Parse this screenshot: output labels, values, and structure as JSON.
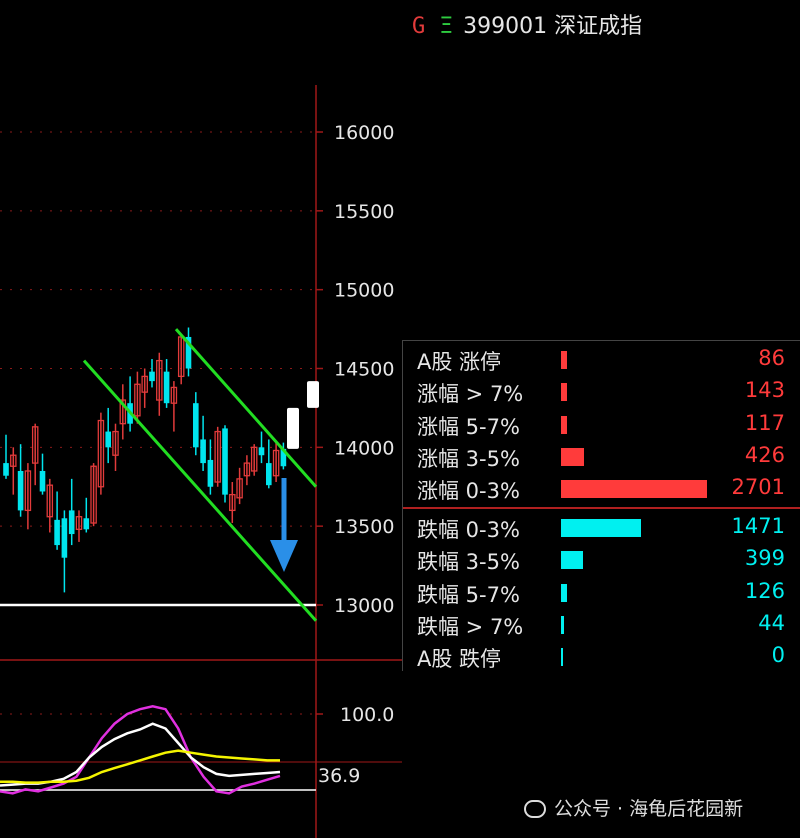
{
  "header": {
    "g_label": "G",
    "eq_label": "Ξ",
    "title": "399001 深证成指"
  },
  "chart_data": [
    {
      "type": "candlestick",
      "title": "",
      "yticks": [
        16000,
        15500,
        15000,
        14500,
        14000,
        13500,
        13000
      ],
      "ylim": [
        12900,
        16500
      ],
      "support_level": 13000,
      "channel_upper": [
        [
          14750,
          13750
        ]
      ],
      "channel_lower": [
        [
          14550,
          12900
        ]
      ],
      "colors": {
        "up": "#e23b3b",
        "down": "#00e5ee",
        "channel": "#22dd22",
        "support": "#ffffff",
        "arrow": "#2a8fe8"
      },
      "candles": [
        {
          "o": 13900,
          "h": 14080,
          "l": 13800,
          "c": 13820
        },
        {
          "o": 13880,
          "h": 14000,
          "l": 13700,
          "c": 13950
        },
        {
          "o": 13850,
          "h": 14020,
          "l": 13560,
          "c": 13600
        },
        {
          "o": 13600,
          "h": 13900,
          "l": 13480,
          "c": 13850
        },
        {
          "o": 13900,
          "h": 14150,
          "l": 13760,
          "c": 14130
        },
        {
          "o": 13850,
          "h": 13960,
          "l": 13700,
          "c": 13720
        },
        {
          "o": 13560,
          "h": 13800,
          "l": 13460,
          "c": 13760
        },
        {
          "o": 13540,
          "h": 13720,
          "l": 13350,
          "c": 13380
        },
        {
          "o": 13550,
          "h": 13600,
          "l": 13080,
          "c": 13300
        },
        {
          "o": 13600,
          "h": 13800,
          "l": 13380,
          "c": 13450
        },
        {
          "o": 13480,
          "h": 13600,
          "l": 13400,
          "c": 13560
        },
        {
          "o": 13550,
          "h": 13680,
          "l": 13460,
          "c": 13480
        },
        {
          "o": 13520,
          "h": 13900,
          "l": 13500,
          "c": 13880
        },
        {
          "o": 13750,
          "h": 14220,
          "l": 13700,
          "c": 14170
        },
        {
          "o": 14100,
          "h": 14250,
          "l": 13900,
          "c": 14000
        },
        {
          "o": 13950,
          "h": 14150,
          "l": 13850,
          "c": 14100
        },
        {
          "o": 14150,
          "h": 14400,
          "l": 14050,
          "c": 14300
        },
        {
          "o": 14280,
          "h": 14450,
          "l": 14100,
          "c": 14150
        },
        {
          "o": 14200,
          "h": 14480,
          "l": 14150,
          "c": 14400
        },
        {
          "o": 14350,
          "h": 14500,
          "l": 14250,
          "c": 14450
        },
        {
          "o": 14480,
          "h": 14560,
          "l": 14380,
          "c": 14420
        },
        {
          "o": 14300,
          "h": 14600,
          "l": 14200,
          "c": 14550
        },
        {
          "o": 14480,
          "h": 14560,
          "l": 14250,
          "c": 14280
        },
        {
          "o": 14280,
          "h": 14420,
          "l": 14100,
          "c": 14380
        },
        {
          "o": 14450,
          "h": 14720,
          "l": 14400,
          "c": 14700
        },
        {
          "o": 14700,
          "h": 14760,
          "l": 14450,
          "c": 14500
        },
        {
          "o": 14280,
          "h": 14350,
          "l": 13950,
          "c": 14000
        },
        {
          "o": 14050,
          "h": 14200,
          "l": 13850,
          "c": 13900
        },
        {
          "o": 13920,
          "h": 14050,
          "l": 13700,
          "c": 13750
        },
        {
          "o": 13780,
          "h": 14130,
          "l": 13750,
          "c": 14100
        },
        {
          "o": 14120,
          "h": 14140,
          "l": 13650,
          "c": 13700
        },
        {
          "o": 13600,
          "h": 13780,
          "l": 13520,
          "c": 13700
        },
        {
          "o": 13680,
          "h": 13870,
          "l": 13640,
          "c": 13800
        },
        {
          "o": 13820,
          "h": 13950,
          "l": 13760,
          "c": 13900
        },
        {
          "o": 13850,
          "h": 14020,
          "l": 13820,
          "c": 14000
        },
        {
          "o": 14000,
          "h": 14100,
          "l": 13900,
          "c": 13950
        },
        {
          "o": 13900,
          "h": 14050,
          "l": 13740,
          "c": 13760
        },
        {
          "o": 13820,
          "h": 14040,
          "l": 13780,
          "c": 13980
        },
        {
          "o": 13990,
          "h": 14030,
          "l": 13860,
          "c": 13880
        }
      ],
      "projected_candles": [
        {
          "o": 13990,
          "h": 14250,
          "l": 13990,
          "c": 14250
        },
        {
          "o": 14250,
          "h": 14420,
          "l": 14250,
          "c": 14420
        }
      ]
    },
    {
      "type": "line",
      "title": "",
      "yticks": [
        100.0
      ],
      "ylim": [
        -10,
        130
      ],
      "current_value_label": "36.9",
      "series": [
        {
          "color": "#e030e0",
          "values": [
            20,
            18,
            22,
            20,
            24,
            28,
            35,
            55,
            75,
            90,
            100,
            105,
            108,
            105,
            85,
            55,
            35,
            20,
            18,
            25,
            28,
            32,
            36
          ]
        },
        {
          "color": "#ffffff",
          "values": [
            26,
            27,
            28,
            28,
            30,
            33,
            40,
            55,
            66,
            74,
            80,
            84,
            90,
            85,
            70,
            55,
            45,
            38,
            36,
            37,
            38,
            39,
            40
          ]
        },
        {
          "color": "#f4f400",
          "values": [
            30,
            30,
            29,
            29,
            30,
            30,
            31,
            34,
            40,
            44,
            48,
            52,
            56,
            60,
            62,
            60,
            58,
            56,
            55,
            54,
            53,
            52,
            52
          ]
        }
      ]
    }
  ],
  "breadth": {
    "rows": [
      {
        "label": "A股 涨停",
        "value": "86",
        "count": 86,
        "side": "up"
      },
      {
        "label": "涨幅 > 7%",
        "value": "143",
        "count": 143,
        "side": "up"
      },
      {
        "label": "涨幅 5-7%",
        "value": "117",
        "count": 117,
        "side": "up"
      },
      {
        "label": "涨幅 3-5%",
        "value": "426",
        "count": 426,
        "side": "up"
      },
      {
        "label": "涨幅 0-3%",
        "value": "2701",
        "count": 2701,
        "side": "up"
      },
      {
        "label": "跌幅 0-3%",
        "value": "1471",
        "count": 1471,
        "side": "down"
      },
      {
        "label": "跌幅 3-5%",
        "value": "399",
        "count": 399,
        "side": "down"
      },
      {
        "label": "跌幅 5-7%",
        "value": "126",
        "count": 126,
        "side": "down"
      },
      {
        "label": "跌幅 > 7%",
        "value": "44",
        "count": 44,
        "side": "down"
      },
      {
        "label": "A股 跌停",
        "value": "0",
        "count": 0,
        "side": "down"
      }
    ],
    "colors": {
      "up": "#ff3b3b",
      "down": "#00f0f0"
    }
  },
  "watermark": {
    "text": "公众号 · 海龟后花园新"
  }
}
